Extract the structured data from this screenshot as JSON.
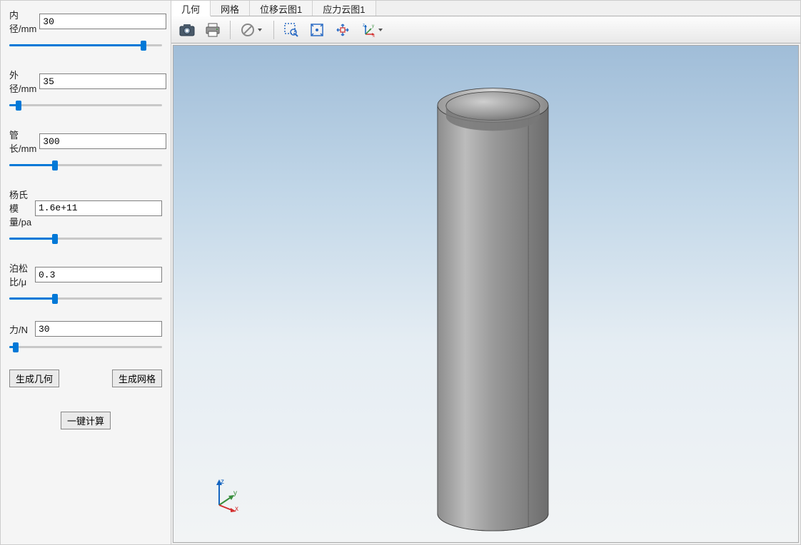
{
  "params": [
    {
      "label": "内径/mm",
      "value": "30",
      "slider_pct": 88
    },
    {
      "label": "外径/mm",
      "value": "35",
      "slider_pct": 6
    },
    {
      "label": "管长/mm",
      "value": "300",
      "slider_pct": 30
    },
    {
      "label": "杨氏模量/pa",
      "value": "1.6e+11",
      "slider_pct": 30
    },
    {
      "label": "泊松比/μ",
      "value": "0.3",
      "slider_pct": 30
    },
    {
      "label": "力/N",
      "value": "30",
      "slider_pct": 4
    }
  ],
  "buttons": {
    "gen_geometry": "生成几何",
    "gen_mesh": "生成网格",
    "compute": "一键计算"
  },
  "tabs": [
    {
      "label": "几何",
      "active": true
    },
    {
      "label": "网格",
      "active": false
    },
    {
      "label": "位移云图1",
      "active": false
    },
    {
      "label": "应力云图1",
      "active": false
    }
  ],
  "toolbar_icons": [
    "camera-icon",
    "print-icon",
    "sep",
    "clear-icon-dropdown",
    "sep",
    "zoom-select-icon",
    "zoom-fit-icon",
    "zoom-extents-icon",
    "axes-icon-dropdown"
  ],
  "axis_labels": {
    "x": "x",
    "y": "y",
    "z": "z"
  }
}
